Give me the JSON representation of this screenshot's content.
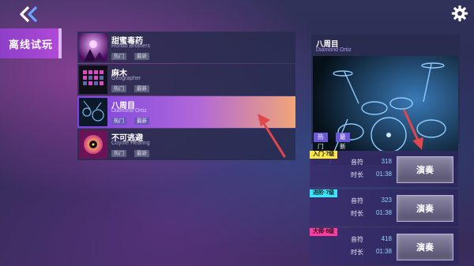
{
  "sidebar": {
    "category_label": "离线试玩"
  },
  "songs": [
    {
      "title": "甜蜜毒药",
      "artist": "Rondo Brothers",
      "tags": [
        "热门",
        "最新"
      ],
      "selected": false
    },
    {
      "title": "麻木",
      "artist": "Geographer",
      "tags": [
        "热门",
        "最新"
      ],
      "selected": false
    },
    {
      "title": "八周目",
      "artist": "Diamond Ortiz",
      "tags": [
        "热门",
        "最新"
      ],
      "selected": true
    },
    {
      "title": "不可逃避",
      "artist": "Coyote Hearing",
      "tags": [
        "热门",
        "最新"
      ],
      "selected": false
    }
  ],
  "preview": {
    "title": "八周目",
    "artist": "Diamond Ortiz",
    "tags": [
      "热门",
      "最新"
    ]
  },
  "difficulties": [
    {
      "badge": "入门·7级",
      "badge_color": "#ffe640",
      "notes_label": "音符",
      "notes": "318",
      "duration_label": "时长",
      "duration": "01:38",
      "play_label": "演奏"
    },
    {
      "badge": "进阶·7级",
      "badge_color": "#39e6ff",
      "notes_label": "音符",
      "notes": "323",
      "duration_label": "时长",
      "duration": "01:38",
      "play_label": "演奏"
    },
    {
      "badge": "大师·8级",
      "badge_color": "#ff3aa0",
      "notes_label": "音符",
      "notes": "418",
      "duration_label": "时长",
      "duration": "01:38",
      "play_label": "演奏"
    }
  ],
  "icons": {
    "back": "double-chevron-left-icon",
    "settings": "gear-icon"
  },
  "colors": {
    "accent": "#8e3fc8",
    "selected_gradient_end": "#f0a578",
    "annotation_arrow": "#e0474c"
  }
}
